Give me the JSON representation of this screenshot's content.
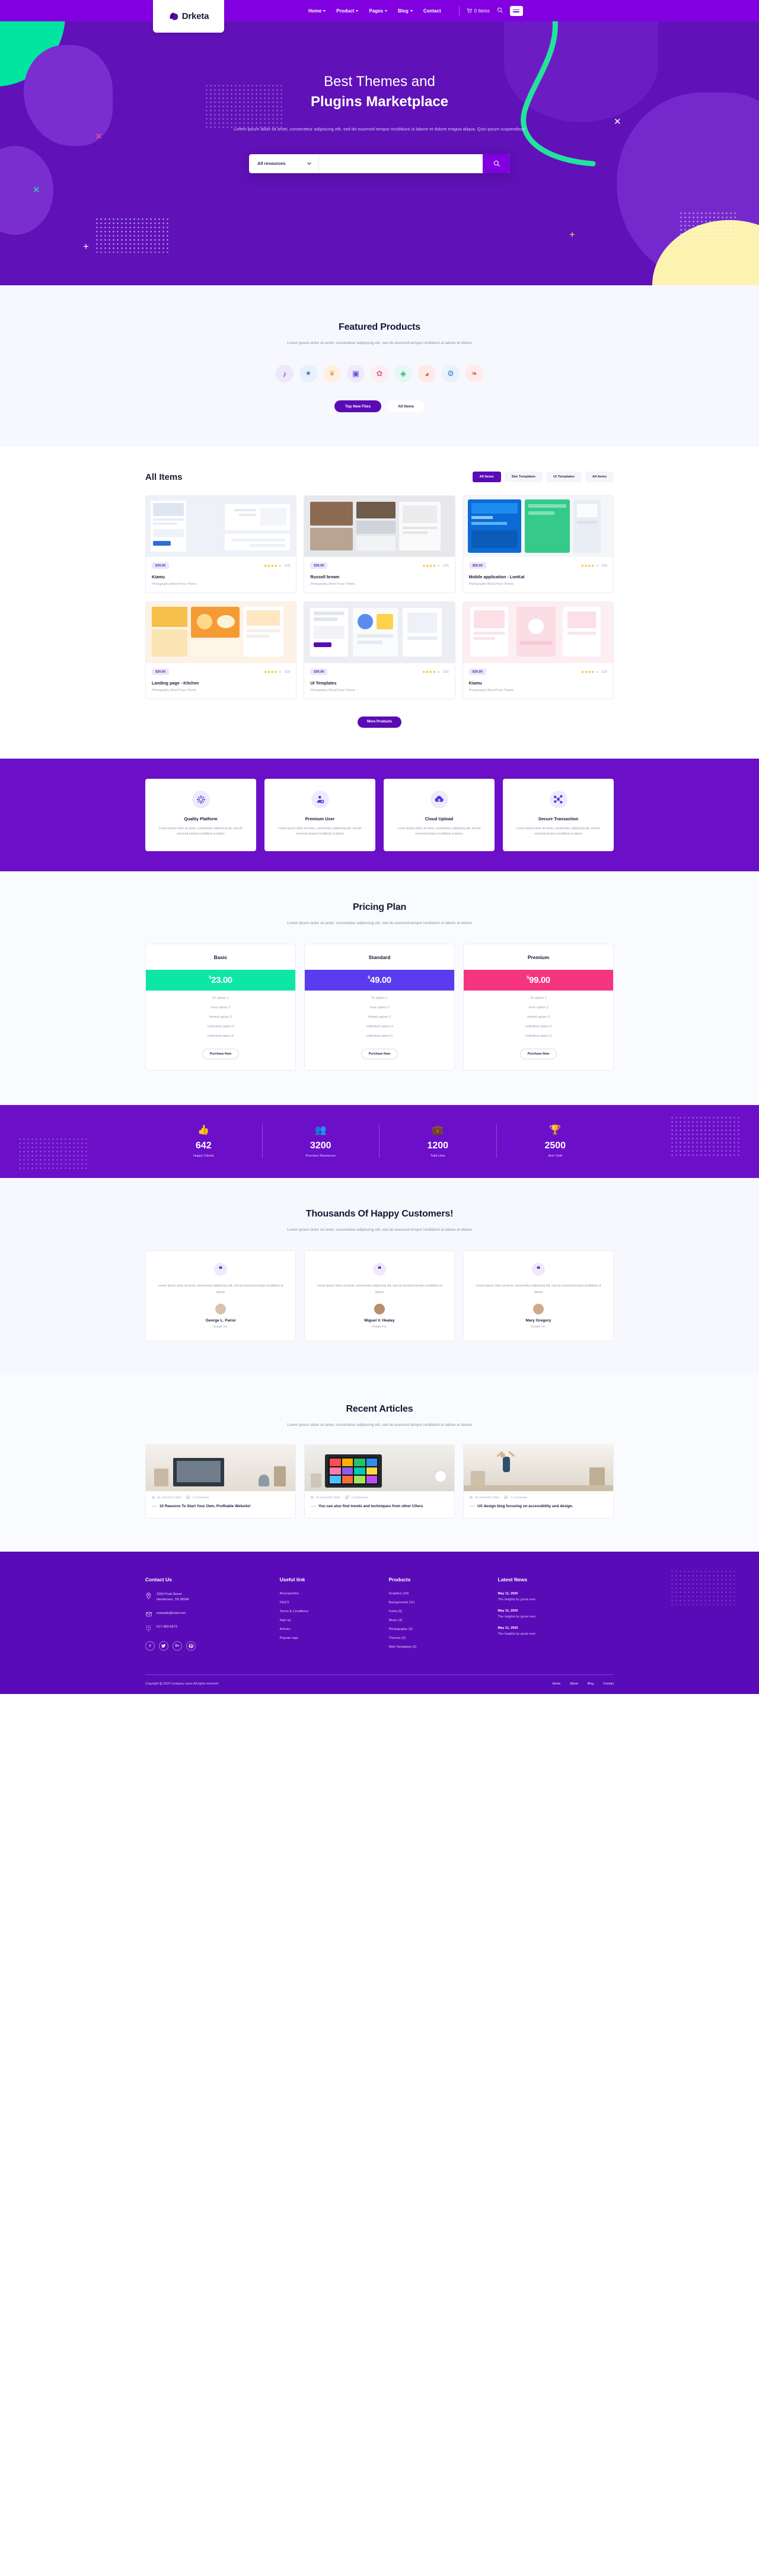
{
  "brand": {
    "name": "Drketa",
    "accent": "#8200e0",
    "hero_bg": "#6011b8",
    "deep": "#5b0bb5"
  },
  "header": {
    "nav": [
      {
        "label": "Home",
        "caret": true
      },
      {
        "label": "Product",
        "caret": true
      },
      {
        "label": "Pages",
        "caret": true
      },
      {
        "label": "Blog",
        "caret": true
      },
      {
        "label": "Contact",
        "caret": false
      }
    ],
    "cart_label": "0 Items",
    "search_icon": "search-icon",
    "menu_icon": "hamburger-icon"
  },
  "hero": {
    "title_line1": "Best Themes and",
    "title_line2": "Plugins Marketplace",
    "paragraph": "Lorem ipsum dolor sit amet, consectetur adipiscing elit, sed do eiusmod tempor incididunt ut labore et dolore magna aliqua. Quis ipsum suspendisse",
    "search": {
      "select": "All resources",
      "placeholder": "",
      "button_icon": "search-icon"
    }
  },
  "featured": {
    "title": "Featured Products",
    "subtitle": "Lorem ipsum dolor sit amet, consectetur adipiscing elit, sed do eiusmod tempor incididunt ut labore et dolore",
    "icons": [
      {
        "name": "music-note-icon",
        "glyph": "♪",
        "bg": "#ede8fb",
        "fg": "#5b0bb5"
      },
      {
        "name": "compass-icon",
        "glyph": "✶",
        "bg": "#e8f0fc",
        "fg": "#2f5fc4"
      },
      {
        "name": "leaf-icon",
        "glyph": "❦",
        "bg": "#fff0e2",
        "fg": "#f2a356"
      },
      {
        "name": "camera-icon",
        "glyph": "▣",
        "bg": "#efeafc",
        "fg": "#6b4fd6"
      },
      {
        "name": "palette-icon",
        "glyph": "✿",
        "bg": "#fdeef2",
        "fg": "#e0628f"
      },
      {
        "name": "cube-icon",
        "glyph": "◈",
        "bg": "#e7f7f1",
        "fg": "#2bb98a"
      },
      {
        "name": "flame-icon",
        "glyph": "◕",
        "bg": "#fdeae8",
        "fg": "#e05a45"
      },
      {
        "name": "gear-icon",
        "glyph": "⚙",
        "bg": "#e9f2fd",
        "fg": "#3e7ad4"
      },
      {
        "name": "ribbon-icon",
        "glyph": "❧",
        "bg": "#fdeceb",
        "fg": "#ea5b4c"
      }
    ],
    "buttons": [
      {
        "label": "Top New Files",
        "style": "solid"
      },
      {
        "label": "All Items",
        "style": "ghost"
      }
    ]
  },
  "all_items": {
    "title": "All Items",
    "tabs": [
      {
        "label": "All Items",
        "active": true
      },
      {
        "label": "Site Templates",
        "active": false
      },
      {
        "label": "UI Templates",
        "active": false
      },
      {
        "label": "All Items",
        "active": false
      }
    ],
    "products": [
      {
        "price": "$30.00",
        "rating": 4,
        "reviews": "(12)",
        "name": "Kiamu",
        "meta": "Photography Word Press Theme",
        "thumb": "dashboard-screenshot"
      },
      {
        "price": "$30.00",
        "rating": 4,
        "reviews": "(12)",
        "name": "Russell brown",
        "meta": "Photography Word Press Theme",
        "thumb": "gallery-screenshot"
      },
      {
        "price": "$30.00",
        "rating": 4,
        "reviews": "(12)",
        "name": "Mobile application - LonKat",
        "meta": "Photography Word Press Theme",
        "thumb": "mobile-app-screenshot"
      },
      {
        "price": "$30.00",
        "rating": 4,
        "reviews": "(12)",
        "name": "Landing page - Kitchen",
        "meta": "Photography Word Press Theme",
        "thumb": "food-landing-screenshot"
      },
      {
        "price": "$30.00",
        "rating": 4,
        "reviews": "(12)",
        "name": "UI Templates",
        "meta": "Photography Word Press Theme",
        "thumb": "ui-kit-screenshot"
      },
      {
        "price": "$30.00",
        "rating": 4,
        "reviews": "(12)",
        "name": "Kiamu",
        "meta": "Photography Word Press Theme",
        "thumb": "pink-app-screenshot"
      }
    ],
    "more_button": "More Products"
  },
  "features": [
    {
      "icon": "network-globe-icon",
      "title": "Quality Platform",
      "text": "Lorem ipsum dolor sit amet, consectetur adipiscing elit, sed do eiusmod tempor incididunt ut labore"
    },
    {
      "icon": "premium-user-icon",
      "title": "Premium User",
      "text": "Lorem ipsum dolor sit amet, consectetur adipiscing elit, sed do eiusmod tempor incididunt ut labore"
    },
    {
      "icon": "cloud-upload-icon",
      "title": "Cloud Upload",
      "text": "Lorem ipsum dolor sit amet, consectetur adipiscing elit, sed do eiusmod tempor incididunt ut labore"
    },
    {
      "icon": "secure-transaction-icon",
      "title": "Secure Transaction",
      "text": "Lorem ipsum dolor sit amet, consectetur adipiscing elit, sed do eiusmod tempor incididunt ut labore"
    }
  ],
  "pricing": {
    "title": "Pricing Plan",
    "subtitle": "Lorem ipsum dolor sit amet, consectetur adipiscing elit, sed do eiusmod tempor incididunt ut labore et dolore",
    "plans": [
      {
        "name": "Basic",
        "currency": "$",
        "amount": "23.00",
        "color": "#0ee6a5",
        "options": [
          "2x option 1",
          "Free option 2",
          "limited option 3",
          "Unlimited option 4",
          "Unlimited option 5"
        ],
        "button": "Purchase Now"
      },
      {
        "name": "Standard",
        "currency": "$",
        "amount": "49.00",
        "color": "#5a3bef",
        "options": [
          "2x option 1",
          "Free option 2",
          "limited option 3",
          "Unlimited option 4",
          "Unlimited option 5"
        ],
        "button": "Purchase Now"
      },
      {
        "name": "Premium",
        "currency": "$",
        "amount": "99.00",
        "color": "#f5357f",
        "options": [
          "2x option 1",
          "Free option 2",
          "limited option 3",
          "Unlimited option 4",
          "Unlimited option 5"
        ],
        "button": "Purchase Now"
      }
    ]
  },
  "stats": [
    {
      "icon": "thumbs-up-icon",
      "glyph": "👍",
      "number": "642",
      "label": "Happy Clients"
    },
    {
      "icon": "users-group-icon",
      "glyph": "👥",
      "number": "3200",
      "label": "Premium Resources"
    },
    {
      "icon": "briefcase-icon",
      "glyph": "💼",
      "number": "1200",
      "label": "Total User"
    },
    {
      "icon": "trophy-icon",
      "glyph": "🏆",
      "number": "2500",
      "label": "Item Sold"
    }
  ],
  "testimonials": {
    "title": "Thousands Of Happy Customers!",
    "subtitle": "Lorem ipsum dolor sit amet, consectetur adipiscing elit, sed do eiusmod tempor incididunt ut labore et dolore",
    "items": [
      {
        "quote_icon": "quote-icon",
        "text": "Lorem ipsum dolor sit amet, consectetur adipiscing elit, sed do eiusmod tempor incididunt ut labore",
        "name": "George L. Parisi",
        "role": "Google Inc.",
        "avatar_bg": "#d9c3ad"
      },
      {
        "quote_icon": "quote-icon",
        "text": "Lorem ipsum dolor sit amet, consectetur adipiscing elit, sed do eiusmod tempor incididunt ut labore",
        "name": "Miguel V. Healey",
        "role": "Google Inc.",
        "avatar_bg": "#b78f6c"
      },
      {
        "quote_icon": "quote-icon",
        "text": "Lorem ipsum dolor sit amet, consectetur adipiscing elit, sed do eiusmod tempor incididunt ut labore",
        "name": "Mary Gregory",
        "role": "Google Inc.",
        "avatar_bg": "#cfa98b"
      }
    ]
  },
  "articles": {
    "title": "Recent Articles",
    "subtitle": "Lorem ipsum dolor sit amet, consectetur adipiscing elit, sed do eiusmod tempor incididunt ut labore et dolore",
    "items": [
      {
        "date": "28 JANUARY 2020",
        "comments": "0 Comments",
        "title": "10 Reasons To Start Your Own, Profitable Website!",
        "img": "desk-laptop-photo"
      },
      {
        "date": "28 JANUARY 2020",
        "comments": "0 Comments",
        "title": "You can also find trends and techniques from other UXers",
        "img": "colorful-tablet-photo"
      },
      {
        "date": "28 JANUARY 2020",
        "comments": "0 Comments",
        "title": "UX design blog focusing on accessibility and design.",
        "img": "person-arms-up-photo"
      }
    ]
  },
  "footer": {
    "contact": {
      "heading": "Contact Us",
      "address_line1": "2200 Pratt Street",
      "address_line2": "Henderson, TN 38340",
      "email": "example@mail.com",
      "phone": "517-383-6673",
      "social": [
        {
          "name": "facebook-icon",
          "glyph": "f"
        },
        {
          "name": "twitter-icon",
          "glyph": "ᵛ"
        },
        {
          "name": "google-plus-icon",
          "glyph": "G+"
        },
        {
          "name": "pinterest-icon",
          "glyph": "ρ"
        }
      ]
    },
    "useful": {
      "heading": "Useful link",
      "links": [
        "All properties",
        "FAQ'S",
        "Terms & Conditions",
        "Sign up",
        "Articles",
        "Popular tags"
      ]
    },
    "products": {
      "heading": "Products",
      "links": [
        "Graphics (24)",
        "Backgrounds (11)",
        "Fonts (9)",
        "Music (3)",
        "Photography (3)",
        "Themes (3)",
        "Web Templates (3)"
      ]
    },
    "news": {
      "heading": "Latest News",
      "items": [
        {
          "date": "May 11, 2020",
          "text": "The heights by great men"
        },
        {
          "date": "May 11, 2020",
          "text": "The heights by great men"
        },
        {
          "date": "May 11, 2020",
          "text": "The heights by great men"
        }
      ]
    },
    "bottom": {
      "copyright": "Copyright @ 2020 Company name All rights reserved.",
      "links": [
        "Home",
        "About",
        "Blog",
        "Contact"
      ]
    }
  }
}
